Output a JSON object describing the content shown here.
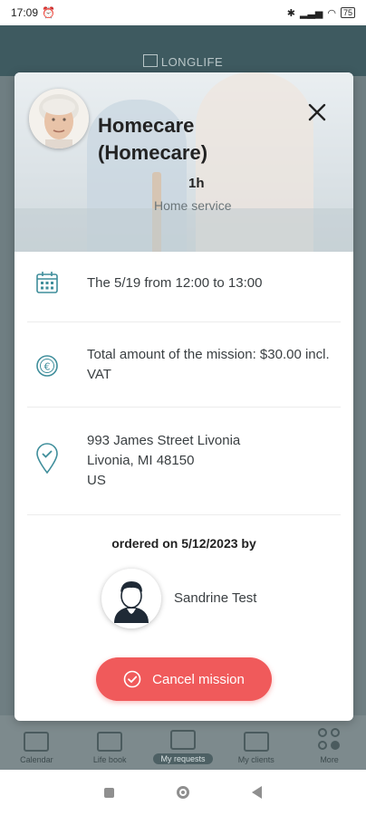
{
  "status_bar": {
    "time": "17:09",
    "battery": "75"
  },
  "app": {
    "brand": "LONGLIFE",
    "bottom_nav": [
      {
        "label": "Calendar"
      },
      {
        "label": "Life book"
      },
      {
        "label": "My requests"
      },
      {
        "label": "My clients"
      },
      {
        "label": "More"
      }
    ]
  },
  "modal": {
    "title": "Homecare (Homecare)",
    "duration": "1h",
    "service_type": "Home service",
    "schedule": "The 5/19 from 12:00 to 13:00",
    "amount": "Total amount of the mission: $30.00 incl. VAT",
    "address_line1": "993 James Street Livonia",
    "address_line2": "Livonia, MI 48150",
    "address_line3": "US",
    "ordered_text": "ordered on 5/12/2023 by",
    "orderer_name": "Sandrine Test",
    "cancel_label": "Cancel mission",
    "icons": {
      "close": "close-icon",
      "schedule": "calendar-icon",
      "amount": "euro-coin-icon",
      "address": "location-pin-icon",
      "cancel": "check-circle-icon"
    },
    "colors": {
      "accent": "#3f8e9b",
      "cancel": "#f05a5b"
    }
  }
}
